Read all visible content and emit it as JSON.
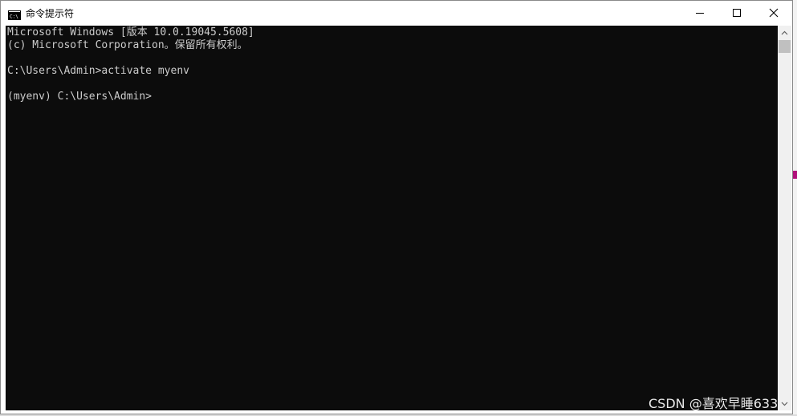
{
  "window": {
    "title": "命令提示符"
  },
  "icons": {
    "app": "cmd-app-icon",
    "minimize": "minimize-icon",
    "maximize": "maximize-icon",
    "close": "close-icon",
    "scroll_up": "scroll-up-arrow-icon",
    "scroll_down": "scroll-down-arrow-icon"
  },
  "console": {
    "lines": [
      "Microsoft Windows [版本 10.0.19045.5608]",
      "(c) Microsoft Corporation。保留所有权利。",
      "",
      "C:\\Users\\Admin>activate myenv",
      "",
      "(myenv) C:\\Users\\Admin>"
    ]
  },
  "watermark": {
    "text": "CSDN @喜欢早睡633"
  },
  "colors": {
    "console_bg": "#0c0c0c",
    "console_fg": "#cccccc",
    "accent_mark": "#b1107b"
  }
}
